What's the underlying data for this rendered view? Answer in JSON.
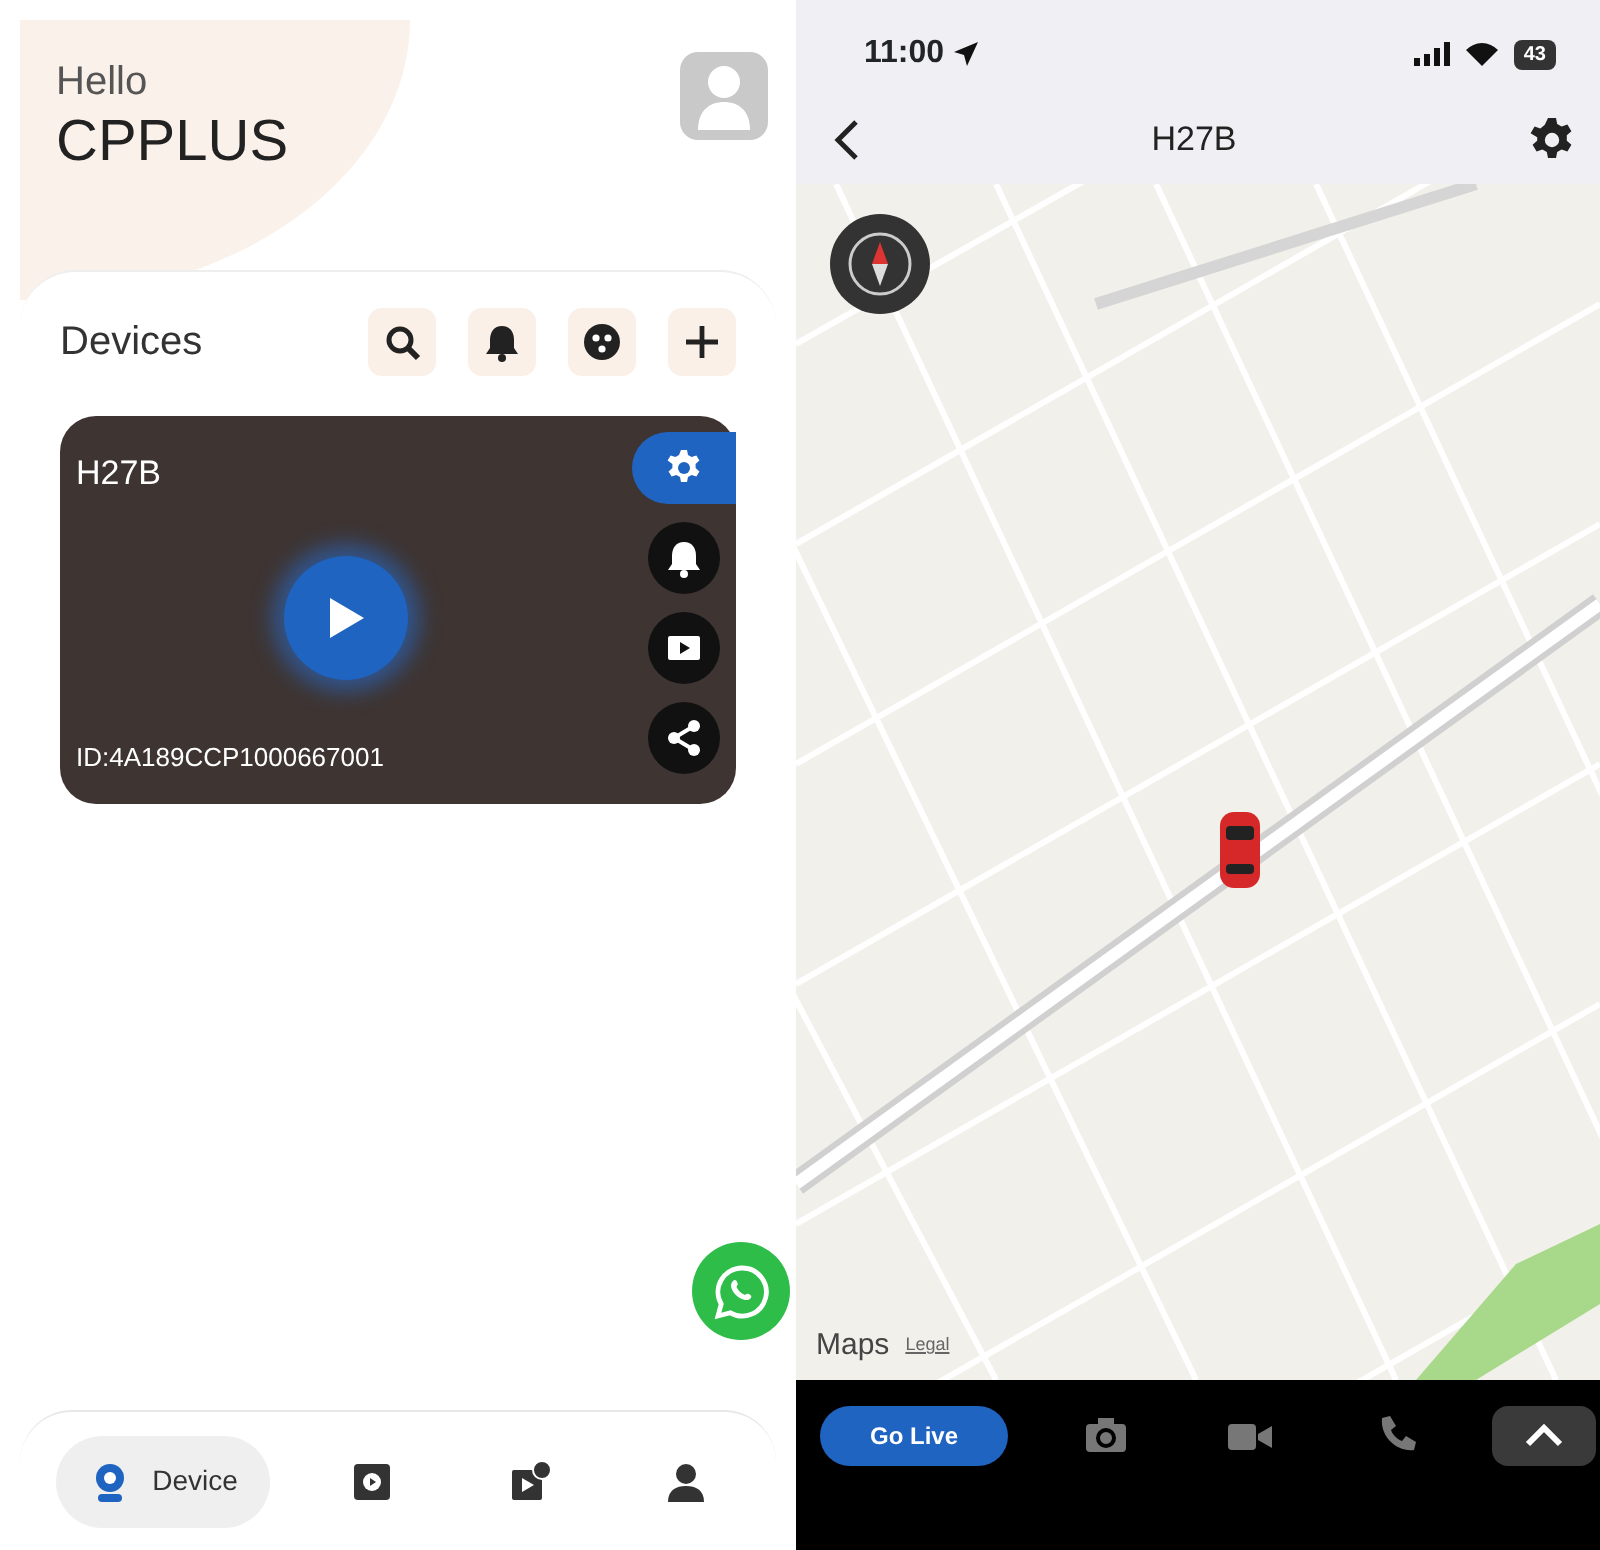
{
  "home": {
    "greeting": "Hello",
    "user": "CPPLUS",
    "section_title": "Devices",
    "tools": [
      {
        "kind": "search"
      },
      {
        "kind": "bell"
      },
      {
        "kind": "dots"
      },
      {
        "kind": "plus"
      }
    ],
    "device": {
      "name": "H27B",
      "id": "ID:4A189CCP1000667001",
      "actions": [
        {
          "kind": "settings",
          "selected": true
        },
        {
          "kind": "bell",
          "selected": false
        },
        {
          "kind": "video",
          "selected": false
        },
        {
          "kind": "share",
          "selected": false
        }
      ]
    },
    "tabs": [
      {
        "kind": "device",
        "label": "Device",
        "selected": true
      },
      {
        "kind": "playback",
        "selected": false
      },
      {
        "kind": "record",
        "selected": false
      },
      {
        "kind": "account",
        "selected": false
      }
    ]
  },
  "map_screen": {
    "status_bar": {
      "time": "11:00",
      "battery": "43"
    },
    "title": "H27B",
    "attribution": {
      "brand": "Maps",
      "legal": "Legal"
    },
    "bottom_bar": {
      "button": "Go Live",
      "tools": [
        {
          "kind": "camera"
        },
        {
          "kind": "video"
        },
        {
          "kind": "phone"
        },
        {
          "kind": "expand"
        }
      ]
    }
  }
}
